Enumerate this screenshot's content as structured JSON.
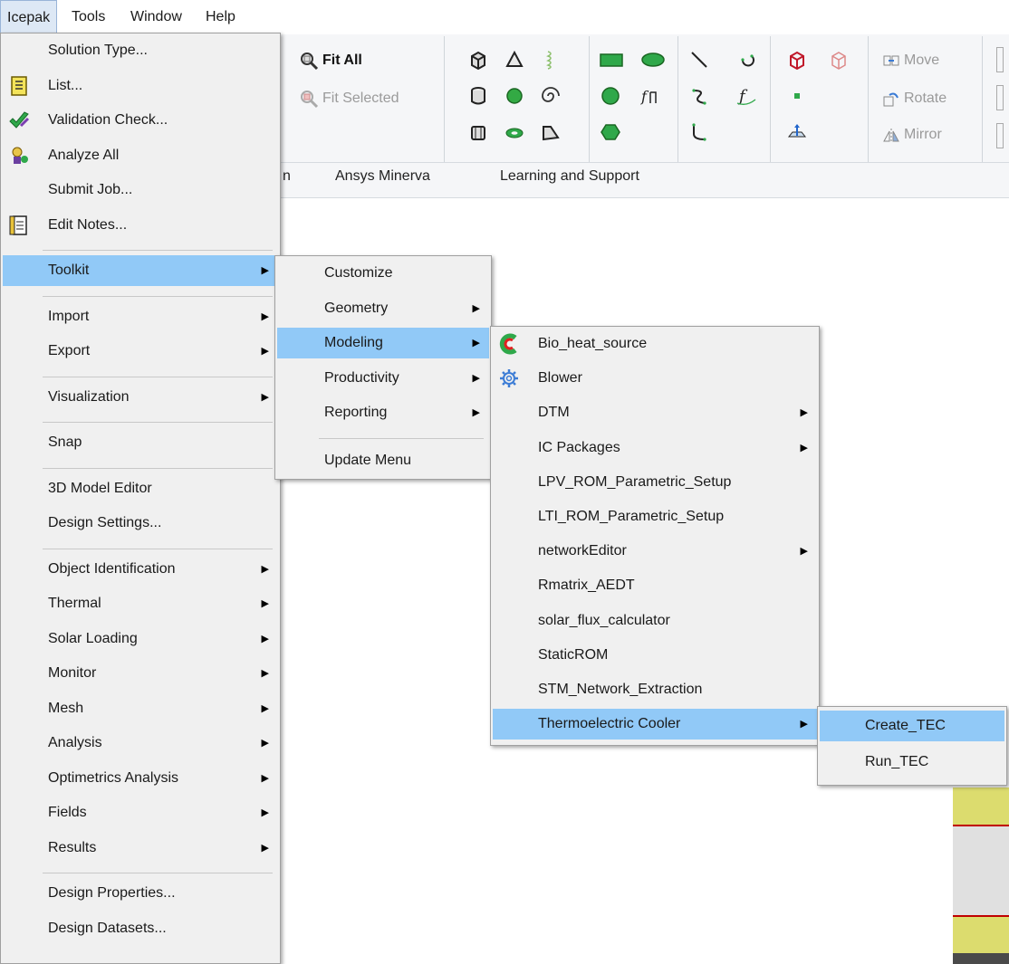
{
  "menubar": {
    "items": [
      "Icepak",
      "Tools",
      "Window",
      "Help"
    ]
  },
  "ribbon": {
    "fit_all": "Fit All",
    "fit_selected": "Fit Selected",
    "move": "Move",
    "rotate": "Rotate",
    "mirror": "Mirror",
    "tabs": [
      "n",
      "Ansys Minerva",
      "Learning and Support"
    ]
  },
  "icepak_menu": {
    "items": [
      {
        "label": "Solution Type...",
        "icon": "",
        "submenu": false
      },
      {
        "label": "List...",
        "icon": "list-icon",
        "submenu": false
      },
      {
        "label": "Validation Check...",
        "icon": "validation-check-icon",
        "submenu": false
      },
      {
        "label": "Analyze All",
        "icon": "analyze-all-icon",
        "submenu": false
      },
      {
        "label": "Submit Job...",
        "icon": "",
        "submenu": false
      },
      {
        "label": "Edit Notes...",
        "icon": "edit-notes-icon",
        "submenu": false
      },
      {
        "label": "Toolkit",
        "icon": "",
        "submenu": true,
        "highlighted": true
      },
      {
        "label": "Import",
        "icon": "",
        "submenu": true
      },
      {
        "label": "Export",
        "icon": "",
        "submenu": true
      },
      {
        "label": "Visualization",
        "icon": "",
        "submenu": true
      },
      {
        "label": "Snap",
        "icon": "",
        "submenu": false
      },
      {
        "label": "3D Model Editor",
        "icon": "",
        "submenu": false
      },
      {
        "label": "Design Settings...",
        "icon": "",
        "submenu": false
      },
      {
        "label": "Object Identification",
        "icon": "",
        "submenu": true
      },
      {
        "label": "Thermal",
        "icon": "",
        "submenu": true
      },
      {
        "label": "Solar Loading",
        "icon": "",
        "submenu": true
      },
      {
        "label": "Monitor",
        "icon": "",
        "submenu": true
      },
      {
        "label": "Mesh",
        "icon": "",
        "submenu": true
      },
      {
        "label": "Analysis",
        "icon": "",
        "submenu": true
      },
      {
        "label": "Optimetrics Analysis",
        "icon": "",
        "submenu": true
      },
      {
        "label": "Fields",
        "icon": "",
        "submenu": true
      },
      {
        "label": "Results",
        "icon": "",
        "submenu": true
      },
      {
        "label": "Design Properties...",
        "icon": "",
        "submenu": false
      },
      {
        "label": "Design Datasets...",
        "icon": "",
        "submenu": false
      }
    ]
  },
  "toolkit_menu": {
    "items": [
      {
        "label": "Customize",
        "submenu": false
      },
      {
        "label": "Geometry",
        "submenu": true
      },
      {
        "label": "Modeling",
        "submenu": true,
        "highlighted": true
      },
      {
        "label": "Productivity",
        "submenu": true
      },
      {
        "label": "Reporting",
        "submenu": true
      },
      {
        "label": "Update Menu",
        "submenu": false
      }
    ]
  },
  "modeling_menu": {
    "items": [
      {
        "label": "Bio_heat_source",
        "icon": "bio-heat-icon",
        "submenu": false
      },
      {
        "label": "Blower",
        "icon": "blower-gear-icon",
        "submenu": false
      },
      {
        "label": "DTM",
        "icon": "",
        "submenu": true
      },
      {
        "label": "IC Packages",
        "icon": "",
        "submenu": true
      },
      {
        "label": "LPV_ROM_Parametric_Setup",
        "icon": "",
        "submenu": false
      },
      {
        "label": "LTI_ROM_Parametric_Setup",
        "icon": "",
        "submenu": false
      },
      {
        "label": "networkEditor",
        "icon": "",
        "submenu": true
      },
      {
        "label": "Rmatrix_AEDT",
        "icon": "",
        "submenu": false
      },
      {
        "label": "solar_flux_calculator",
        "icon": "",
        "submenu": false
      },
      {
        "label": "StaticROM",
        "icon": "",
        "submenu": false
      },
      {
        "label": "STM_Network_Extraction",
        "icon": "",
        "submenu": false
      },
      {
        "label": "Thermoelectric Cooler",
        "icon": "",
        "submenu": true,
        "highlighted": true
      }
    ]
  },
  "tec_menu": {
    "items": [
      {
        "label": "Create_TEC",
        "highlighted": true
      },
      {
        "label": "Run_TEC",
        "highlighted": false
      }
    ]
  },
  "colors": {
    "menu_bg": "#f0f0f0",
    "highlight": "#91c9f7",
    "ribbon_bg": "#f5f6f8",
    "canvas_yellow": "#dcdc6e",
    "canvas_gray": "#e0e0e0",
    "canvas_dark": "#4a4a4a",
    "canvas_line": "#c00000"
  }
}
